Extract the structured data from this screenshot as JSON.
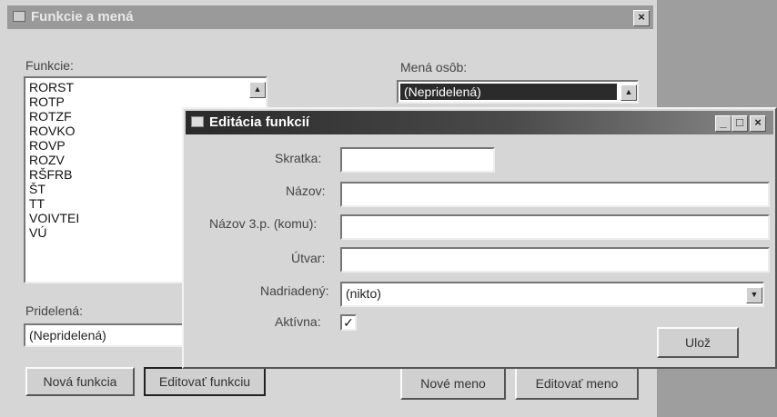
{
  "bg_window": {
    "title": "Funkcie a mená",
    "close_glyph": "×",
    "functions_label": "Funkcie:",
    "functions": [
      "RORST",
      "ROTP",
      "ROTZF",
      "ROVKO",
      "ROVP",
      "ROZV",
      "RŠFRB",
      "ŠT",
      "TT",
      "VOIVTEI",
      "VÚ"
    ],
    "names_label": "Mená osôb:",
    "names_selected": "(Nepridelená)",
    "assigned_label": "Pridelená:",
    "assigned_value": "(Nepridelená)",
    "buttons": {
      "new_function": "Nová funkcia",
      "edit_function": "Editovať funkciu",
      "new_name": "Nové meno",
      "edit_name": "Editovať meno"
    }
  },
  "dialog": {
    "title": "Editácia funkcií",
    "fields": {
      "abbrev_label": "Skratka:",
      "abbrev_value": "",
      "name_label": "Názov:",
      "name_value": "",
      "name3p_label": "Názov 3.p. (komu):",
      "name3p_value": "",
      "unit_label": "Útvar:",
      "unit_value": "",
      "superior_label": "Nadriadený:",
      "superior_value": "(nikto)",
      "active_label": "Aktívna:",
      "active_checked": true
    },
    "save_label": "Ulož"
  },
  "icons": {
    "window_icon": "app-icon",
    "up_arrow": "▲",
    "down_arrow": "▼",
    "check": "✓"
  }
}
